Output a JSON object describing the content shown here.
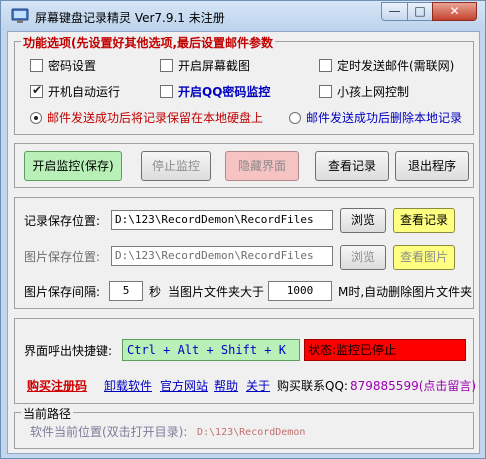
{
  "window": {
    "title": "屏幕键盘记录精灵 Ver7.9.1  未注册",
    "minimize": "—",
    "maximize": "□",
    "close": "✕"
  },
  "options": {
    "legend": "功能选项(先设置好其他选项,最后设置邮件参数",
    "password": {
      "label": "密码设置",
      "checked": false
    },
    "screenshot": {
      "label": "开启屏幕截图",
      "checked": false
    },
    "timed_mail": {
      "label": "定时发送邮件(需联网)",
      "checked": false
    },
    "autostart": {
      "label": "开机自动运行",
      "checked": true
    },
    "qq_monitor": {
      "label": "开启QQ密码监控",
      "checked": false
    },
    "kid_control": {
      "label": "小孩上网控制",
      "checked": false
    },
    "radio_keep": {
      "label": "邮件发送成功后将记录保留在本地硬盘上",
      "selected": true
    },
    "radio_delete": {
      "label": "邮件发送成功后删除本地记录",
      "selected": false
    }
  },
  "actions": {
    "start": "开启监控(保存)",
    "stop": "停止监控",
    "hide": "隐藏界面",
    "view": "查看记录",
    "exit": "退出程序"
  },
  "paths": {
    "record_label": "记录保存位置:",
    "record_value": "D:\\123\\RecordDemon\\RecordFiles",
    "browse": "浏览",
    "view_record": "查看记录",
    "image_label": "图片保存位置:",
    "image_value": "D:\\123\\RecordDemon\\RecordFiles",
    "browse2": "浏览",
    "view_image": "查看图片",
    "interval_label": "图片保存间隔:",
    "interval_value": "5",
    "interval_unit": "秒",
    "size_label": "当图片文件夹大于",
    "size_value": "1000",
    "size_suffix": "M时,自动删除图片文件夹"
  },
  "hotkey": {
    "label": "界面呼出快捷键:",
    "value": "Ctrl + Alt + Shift + K",
    "status": "状态:监控已停止"
  },
  "links": {
    "buy": "购买注册码",
    "uninstall": "卸载软件",
    "website": "官方网站",
    "help": "帮助",
    "about": "关于",
    "contact_label": "购买联系QQ:",
    "contact_value": "879885599(点击留言)"
  },
  "current_path": {
    "legend": "当前路径",
    "label": "软件当前位置(双击打开目录):",
    "value": "D:\\123\\RecordDemon"
  },
  "colors": {
    "start_button": "#b8f0b8",
    "hide_button": "#f6c3c3",
    "view_button": "#ffff80",
    "status_bg": "#ff0000",
    "hotkey_bg": "#b8f0b8"
  }
}
